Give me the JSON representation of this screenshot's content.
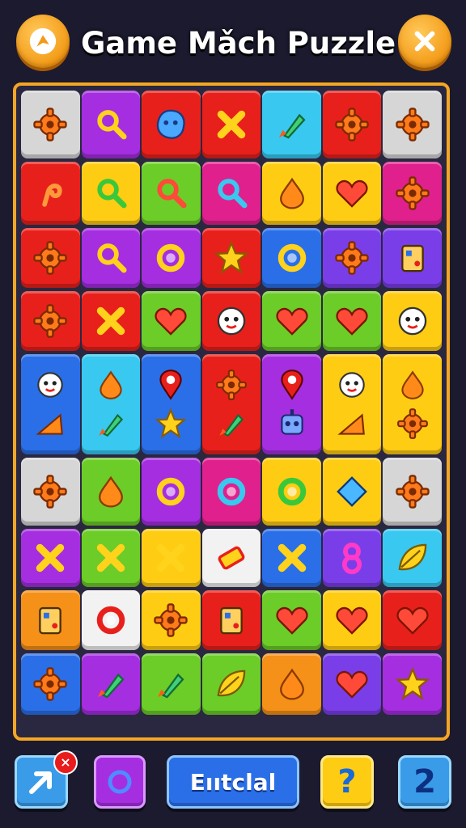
{
  "header": {
    "title": "Game Mǎch Puzzle",
    "left_button_icon": "speech-bubble-icon",
    "right_button_icon": "close-icon"
  },
  "colors": {
    "board_border": "#f5a623",
    "background": "#1b1a2e",
    "header_button": "#f39a16"
  },
  "board": {
    "rows": [
      [
        {
          "color": "gray",
          "icons": [
            "gear-icon"
          ]
        },
        {
          "color": "purple",
          "icons": [
            "magnifier-icon"
          ]
        },
        {
          "color": "red",
          "icons": [
            "blob-icon"
          ]
        },
        {
          "color": "red",
          "icons": [
            "cross-icon"
          ]
        },
        {
          "color": "cyan",
          "icons": [
            "rocket-icon"
          ]
        },
        {
          "color": "red",
          "icons": [
            "gear-icon"
          ]
        },
        {
          "color": "gray",
          "icons": [
            "gear-icon"
          ]
        }
      ],
      [
        {
          "color": "red",
          "icons": [
            "hook-icon"
          ]
        },
        {
          "color": "yellow",
          "icons": [
            "magnifier-icon"
          ]
        },
        {
          "color": "green",
          "icons": [
            "magnifier-icon"
          ]
        },
        {
          "color": "magenta",
          "icons": [
            "magnifier-icon"
          ]
        },
        {
          "color": "yellow",
          "icons": [
            "drop-icon"
          ]
        },
        {
          "color": "yellow",
          "icons": [
            "heart-icon"
          ]
        },
        {
          "color": "magenta",
          "icons": [
            "gear-icon"
          ]
        }
      ],
      [
        {
          "color": "red",
          "icons": [
            "gear-icon"
          ]
        },
        {
          "color": "purple",
          "icons": [
            "magnifier-icon"
          ]
        },
        {
          "color": "purple",
          "icons": [
            "ring-icon"
          ]
        },
        {
          "color": "red",
          "icons": [
            "star-icon"
          ]
        },
        {
          "color": "blue",
          "icons": [
            "ring-icon"
          ]
        },
        {
          "color": "violet",
          "icons": [
            "gear-icon"
          ]
        },
        {
          "color": "violet",
          "icons": [
            "box-icon"
          ]
        }
      ],
      [
        {
          "color": "red",
          "icons": [
            "gear-icon"
          ]
        },
        {
          "color": "red",
          "icons": [
            "cross-icon"
          ]
        },
        {
          "color": "green",
          "icons": [
            "heart-icon"
          ]
        },
        {
          "color": "red",
          "icons": [
            "face-icon"
          ]
        },
        {
          "color": "green",
          "icons": [
            "heart-icon"
          ]
        },
        {
          "color": "green",
          "icons": [
            "heart-icon"
          ]
        },
        {
          "color": "yellow",
          "icons": [
            "face-icon"
          ]
        }
      ],
      [
        {
          "color": "blue",
          "icons": [
            "face-icon",
            "wedge-icon"
          ]
        },
        {
          "color": "cyan",
          "icons": [
            "drop-icon",
            "rocket-icon"
          ]
        },
        {
          "color": "blue",
          "icons": [
            "pin-icon",
            "star-icon"
          ]
        },
        {
          "color": "red",
          "icons": [
            "gear-icon",
            "rocket-icon"
          ]
        },
        {
          "color": "purple",
          "icons": [
            "pin-icon",
            "robot-icon"
          ]
        },
        {
          "color": "yellow",
          "icons": [
            "face-icon",
            "wedge-icon"
          ]
        },
        {
          "color": "yellow",
          "icons": [
            "drop-icon",
            "gear-icon"
          ]
        }
      ],
      [
        {
          "color": "gray",
          "icons": [
            "gear-icon"
          ]
        },
        {
          "color": "green",
          "icons": [
            "drop-icon"
          ]
        },
        {
          "color": "purple",
          "icons": [
            "ring-icon"
          ]
        },
        {
          "color": "magenta",
          "icons": [
            "ring-icon"
          ]
        },
        {
          "color": "yellow",
          "icons": [
            "ring-icon"
          ]
        },
        {
          "color": "yellow",
          "icons": [
            "diamond-icon"
          ]
        },
        {
          "color": "gray",
          "icons": [
            "gear-icon"
          ]
        }
      ],
      [
        {
          "color": "purple",
          "icons": [
            "cross-icon"
          ]
        },
        {
          "color": "green",
          "icons": [
            "cross-icon"
          ]
        },
        {
          "color": "yellow",
          "icons": [
            "cross-icon"
          ]
        },
        {
          "color": "white",
          "icons": [
            "bar-icon"
          ]
        },
        {
          "color": "blue",
          "icons": [
            "cross-icon"
          ]
        },
        {
          "color": "violet",
          "icons": [
            "eight-icon"
          ]
        },
        {
          "color": "cyan",
          "icons": [
            "leaf-icon"
          ]
        }
      ],
      [
        {
          "color": "orange",
          "icons": [
            "box-icon"
          ]
        },
        {
          "color": "white",
          "icons": [
            "ring-icon"
          ]
        },
        {
          "color": "yellow",
          "icons": [
            "gear-icon"
          ]
        },
        {
          "color": "red",
          "icons": [
            "box-icon"
          ]
        },
        {
          "color": "green",
          "icons": [
            "heart-icon"
          ]
        },
        {
          "color": "yellow",
          "icons": [
            "heart-icon"
          ]
        },
        {
          "color": "red",
          "icons": [
            "heart-icon"
          ]
        }
      ],
      [
        {
          "color": "blue",
          "icons": [
            "gear-icon"
          ]
        },
        {
          "color": "purple",
          "icons": [
            "rocket-icon"
          ]
        },
        {
          "color": "green",
          "icons": [
            "rocket-icon"
          ]
        },
        {
          "color": "green",
          "icons": [
            "leaf-icon"
          ]
        },
        {
          "color": "orange",
          "icons": [
            "drop-icon"
          ]
        },
        {
          "color": "violet",
          "icons": [
            "heart-icon"
          ]
        },
        {
          "color": "purple",
          "icons": [
            "star-icon"
          ]
        }
      ]
    ]
  },
  "bottom_bar": {
    "arrow_icon": "arrow-icon",
    "badge": "×",
    "ring_icon": "ring-icon",
    "main_label": "Eııtclal",
    "help_label": "?",
    "count_label": "2"
  }
}
